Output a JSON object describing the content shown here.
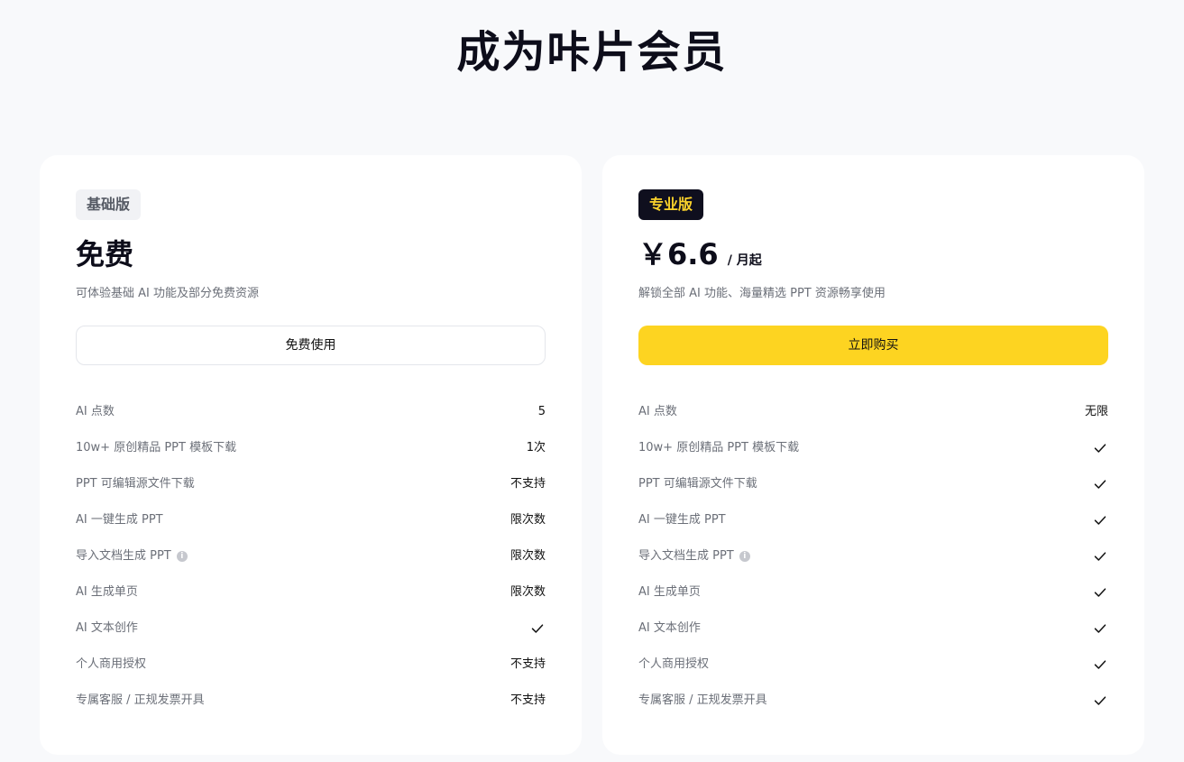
{
  "page": {
    "title": "成为咔片会员"
  },
  "plans": {
    "basic": {
      "badge": "基础版",
      "price": "免费",
      "description": "可体验基础 AI 功能及部分免费资源",
      "button": "免费使用",
      "features": [
        {
          "label": "AI 点数",
          "value": "5"
        },
        {
          "label": "10w+ 原创精品 PPT 模板下载",
          "value": "1次"
        },
        {
          "label": "PPT 可编辑源文件下载",
          "value": "不支持"
        },
        {
          "label": "AI 一键生成 PPT",
          "value": "限次数"
        },
        {
          "label": "导入文档生成 PPT",
          "value": "限次数",
          "info": true
        },
        {
          "label": "AI 生成单页",
          "value": "限次数"
        },
        {
          "label": "AI 文本创作",
          "value": "check"
        },
        {
          "label": "个人商用授权",
          "value": "不支持"
        },
        {
          "label": "专属客服 / 正规发票开具",
          "value": "不支持"
        }
      ]
    },
    "pro": {
      "badge": "专业版",
      "price": "￥6.6",
      "price_unit": "/ 月起",
      "description": "解锁全部 AI 功能、海量精选 PPT 资源畅享使用",
      "button": "立即购买",
      "features": [
        {
          "label": "AI 点数",
          "value": "无限"
        },
        {
          "label": "10w+ 原创精品 PPT 模板下载",
          "value": "check"
        },
        {
          "label": "PPT 可编辑源文件下载",
          "value": "check"
        },
        {
          "label": "AI 一键生成 PPT",
          "value": "check"
        },
        {
          "label": "导入文档生成 PPT",
          "value": "check",
          "info": true
        },
        {
          "label": "AI 生成单页",
          "value": "check"
        },
        {
          "label": "AI 文本创作",
          "value": "check"
        },
        {
          "label": "个人商用授权",
          "value": "check"
        },
        {
          "label": "专属客服 / 正规发票开具",
          "value": "check"
        }
      ]
    }
  },
  "icons": {
    "check": "check-icon",
    "info": "info-icon"
  },
  "colors": {
    "accent": "#fdd421",
    "pro_badge_bg": "#0f0f1e",
    "pro_badge_text": "#fcd32b",
    "background": "#f8f9fb"
  }
}
